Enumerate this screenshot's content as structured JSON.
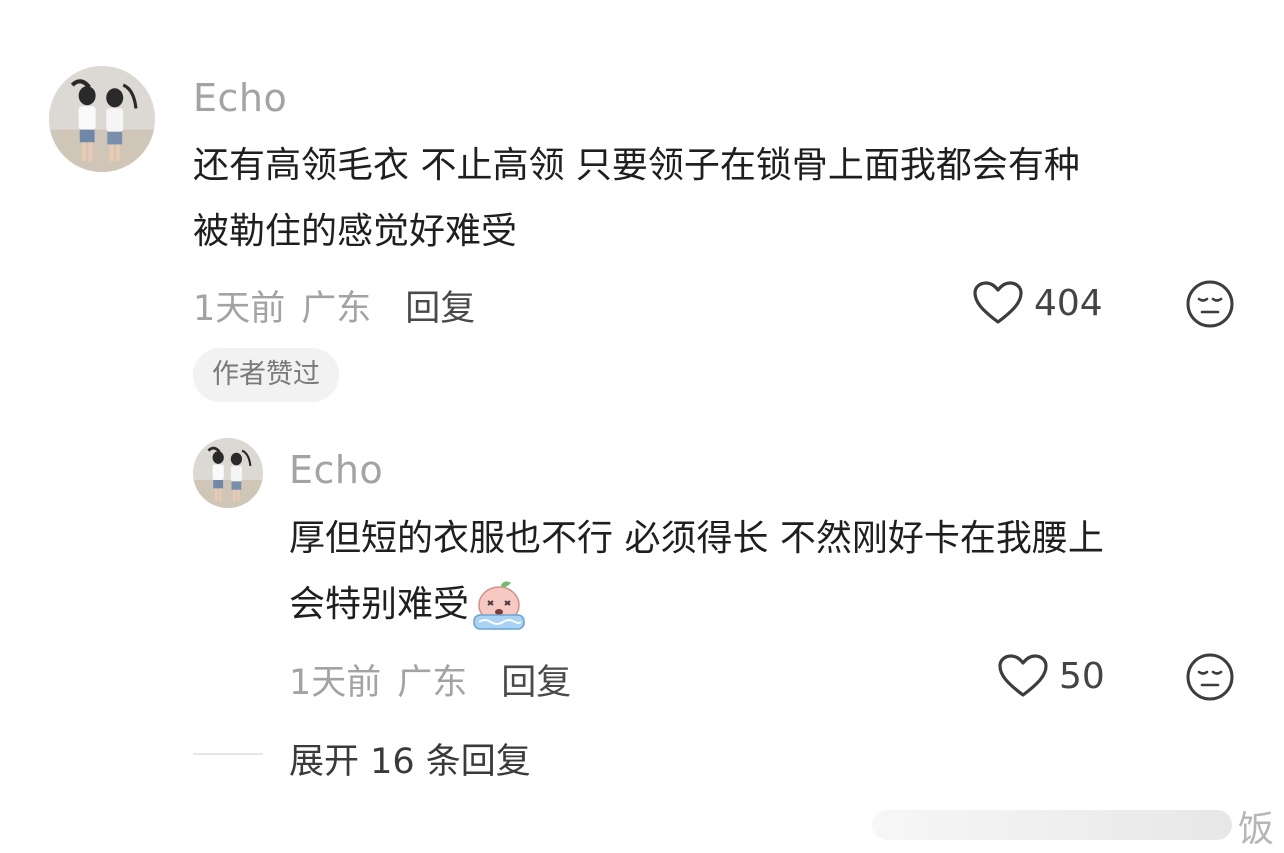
{
  "comments": [
    {
      "username": "Echo",
      "lines": [
        "还有高领毛衣 不止高领 只要领子在锁骨上面我都会有种",
        "被勒住的感觉好难受"
      ],
      "time": "1天前",
      "location": "广东",
      "reply_label": "回复",
      "likes": "404",
      "badge": "作者赞过"
    },
    {
      "username": "Echo",
      "lines": [
        "厚但短的衣服也不行 必须得长 不然刚好卡在我腰上",
        "会特别难受"
      ],
      "time": "1天前",
      "location": "广东",
      "reply_label": "回复",
      "likes": "50"
    }
  ],
  "expand_label": "展开 16 条回复",
  "watermark_char": "饭",
  "colors": {
    "username": "#a3a3a3",
    "text": "#1f1f1f",
    "meta": "#a3a3a3",
    "badge_bg": "#f2f2f2"
  }
}
